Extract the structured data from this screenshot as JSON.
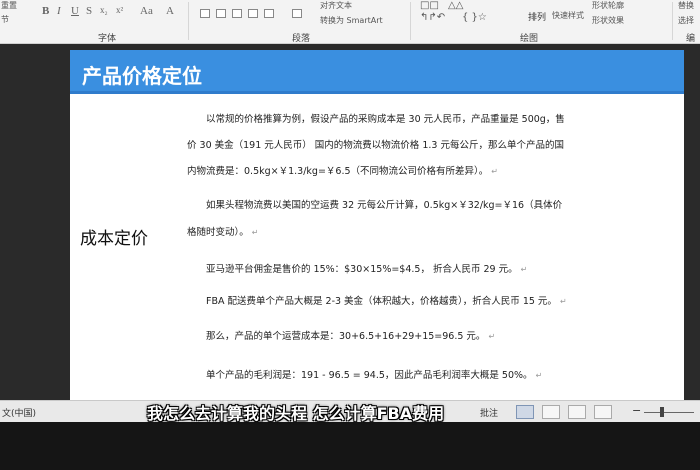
{
  "ribbon": {
    "top_left_1": "重置",
    "top_left_2": "节",
    "font_tools": [
      "B",
      "I",
      "U",
      "S",
      "x₂",
      "x²",
      "A",
      "Aa",
      "A"
    ],
    "para_item_1": "对齐文本",
    "para_item_2": "转换为 SmartArt",
    "arrange_label": "排列",
    "quick_style_label": "快速样式",
    "shape_outline_label": "形状轮廓",
    "shape_effect_label": "形状效果",
    "replace_label": "替换",
    "select_label": "选择",
    "group_font": "字体",
    "group_paragraph": "段落",
    "group_drawing": "绘图",
    "group_edit": "编"
  },
  "slide": {
    "title": "产品价格定位",
    "side_label": "成本定价",
    "paragraphs": [
      {
        "line": "以常规的价格推算为例，假设产品的采购成本是 30 元人民币，产品重量是 500g，售"
      },
      {
        "line": "价 30 美金（191 元人民币） 国内的物流费以物流价格 1.3 元每公斤，那么单个产品的国"
      },
      {
        "line": "内物流费是：0.5kg×￥1.3/kg=￥6.5（不同物流公司价格有所差异）。"
      },
      {
        "line": "如果头程物流费以美国的空运费 32 元每公斤计算，0.5kg×￥32/kg=￥16（具体价"
      },
      {
        "line": "格随时变动）。"
      },
      {
        "line": "亚马逊平台佣金是售价的 15%：$30×15%=$4.5， 折合人民币 29 元。"
      },
      {
        "line": "FBA 配送费单个产品大概是 2-3 美金（体积越大，价格越贵），折合人民币 15 元。"
      },
      {
        "line": "那么，产品的单个运营成本是：30+6.5+16+29+15=96.5 元。"
      },
      {
        "line": "单个产品的毛利润是：191 - 96.5 = 94.5，因此产品毛利润率大概是 50%。"
      }
    ],
    "return_mark": "↵"
  },
  "statusbar": {
    "language": "文(中国)",
    "comments": "批注"
  },
  "caption": "我怎么去计算我的头程 怎么计算FBA费用",
  "colors": {
    "title_bar": "#3a8fe0",
    "page": "#ffffff",
    "ribbon": "#f3f3f3"
  }
}
